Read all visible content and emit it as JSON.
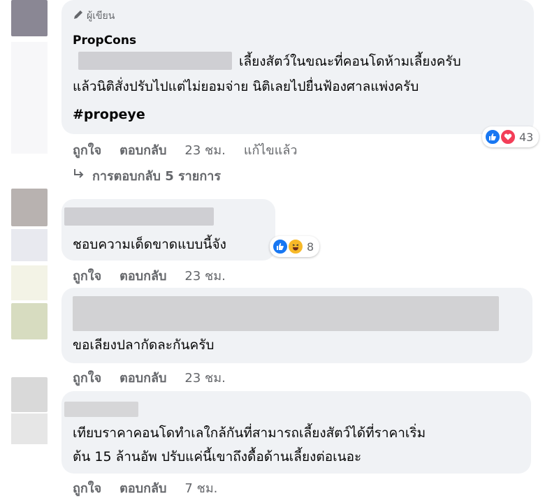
{
  "comments": [
    {
      "author_badge": "ผู้เขียน",
      "author": "PropCons",
      "line1": "เลี้ยงสัตว์ในขณะที่คอนโดห้ามเลี้ยงครับ",
      "line2": "แล้วนิติสั่งปรับไปแต่ไม่ยอมจ่าย นิติเลยไปยื่นฟ้องศาลแพ่งครับ",
      "hashtag": "#propeye",
      "reactions": [
        "like",
        "love"
      ],
      "reaction_count": "43",
      "actions": {
        "like": "ถูกใจ",
        "reply": "ตอบกลับ",
        "time": "23 ชม.",
        "edited": "แก้ไขแล้ว"
      },
      "replies_label": "การตอบกลับ 5 รายการ"
    },
    {
      "line1": "ชอบความเด็ดขาดแบบนี้จัง",
      "reactions": [
        "like",
        "haha"
      ],
      "reaction_count": "8",
      "actions": {
        "like": "ถูกใจ",
        "reply": "ตอบกลับ",
        "time": "23 ชม."
      }
    },
    {
      "line1": "ขอเลียงปลากัดละกันครับ",
      "actions": {
        "like": "ถูกใจ",
        "reply": "ตอบกลับ",
        "time": "23 ชม."
      }
    },
    {
      "line1": "เทียบราคาคอนโดทำเลใกล้กันที่สามารถเลี้ยงสัตว์ได้ที่ราคาเริ่ม",
      "line2": "ต้น 15 ล้านอัพ ปรับแค่นี้เขาถึงดื้อด้านเลี้ยงต่อเนอะ",
      "actions": {
        "like": "ถูกใจ",
        "reply": "ตอบกลับ",
        "time": "7 ชม."
      }
    }
  ],
  "colors": {
    "bubble": "#f0f2f5",
    "meta": "#65676b",
    "like": "#1877f2",
    "love": "#f33e58",
    "haha": "#f7b928"
  }
}
